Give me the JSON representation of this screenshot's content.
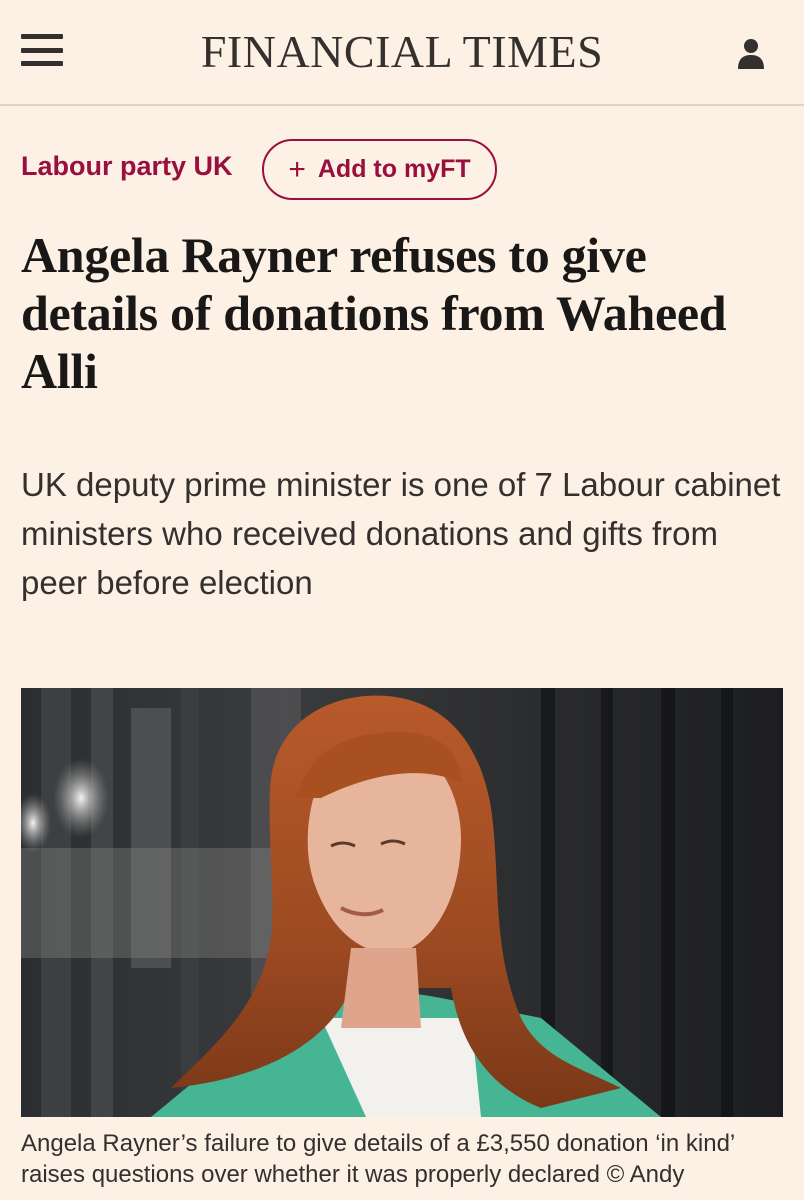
{
  "header": {
    "masthead": "FINANCIAL TIMES",
    "menu_icon": "hamburger-menu-icon",
    "user_icon": "user-account-icon"
  },
  "article": {
    "topic": "Labour party UK",
    "myft_label": "Add to myFT",
    "myft_icon": "+",
    "headline": "Angela Rayner refuses to give details of donations from Waheed Alli",
    "standfirst": "UK deputy prime minister is one of 7 Labour cabinet ministers who received donations and gifts from peer before election",
    "caption": "Angela Rayner’s failure to give details of a £3,550 donation ‘in kind’ raises questions over whether it was properly declared © Andy"
  },
  "colors": {
    "background": "#fdf1e6",
    "brand_claret": "#990f3d",
    "text": "#33302e"
  }
}
